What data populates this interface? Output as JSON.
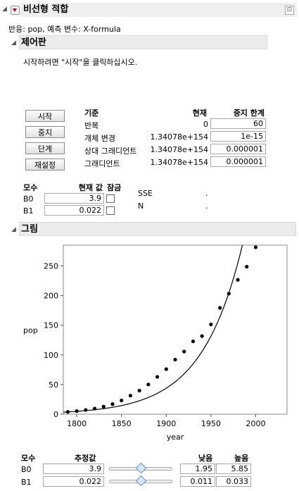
{
  "window": {
    "title": "비선형 적합"
  },
  "response_line": "반응: pop, 예측 변수: X-formula",
  "control_panel": {
    "title": "제어판",
    "instruction": "시작하려면 \"시작\"을 클릭하십시오.",
    "buttons": {
      "start": "시작",
      "stop": "중지",
      "step": "단계",
      "reset": "재설정"
    },
    "criteria_headers": {
      "criterion": "기준",
      "current": "현재",
      "stop_limit": "중지 한계"
    },
    "criteria_rows": [
      {
        "label": "반복",
        "current": "0",
        "limit": "60"
      },
      {
        "label": "개체 변경",
        "current": "1.34078e+154",
        "limit": "1e-15"
      },
      {
        "label": "상대 그래디언트",
        "current": "1.34078e+154",
        "limit": "0.000001"
      },
      {
        "label": "그래디언트",
        "current": "1.34078e+154",
        "limit": "0.000001"
      }
    ],
    "param_headers": {
      "param": "모수",
      "current_value": "현재 값",
      "lock": "잠금"
    },
    "params": [
      {
        "name": "B0",
        "value": "3.9"
      },
      {
        "name": "B1",
        "value": "0.022"
      }
    ],
    "stats": [
      {
        "label": "SSE",
        "value": "."
      },
      {
        "label": "N",
        "value": "."
      }
    ]
  },
  "plot_section": {
    "title": "그림",
    "param_headers": {
      "param": "모수",
      "estimate": "추정값",
      "low": "낮음",
      "high": "높음"
    },
    "params": [
      {
        "name": "B0",
        "estimate": "3.9",
        "low": "1.95",
        "high": "5.85",
        "slider_fraction": 0.5
      },
      {
        "name": "B1",
        "estimate": "0.022",
        "low": "0.011",
        "high": "0.033",
        "slider_fraction": 0.5
      }
    ]
  },
  "chart_data": {
    "type": "scatter",
    "xlabel": "year",
    "ylabel": "pop",
    "xlim": [
      1785,
      2035
    ],
    "ylim": [
      0,
      285
    ],
    "x_ticks": [
      1800,
      1850,
      1900,
      1950,
      2000
    ],
    "y_ticks": [
      0,
      50,
      100,
      150,
      200,
      250
    ],
    "points": [
      [
        1790,
        3.9
      ],
      [
        1800,
        5.3
      ],
      [
        1810,
        7.2
      ],
      [
        1820,
        9.6
      ],
      [
        1830,
        12.9
      ],
      [
        1840,
        17.1
      ],
      [
        1850,
        23.2
      ],
      [
        1860,
        31.4
      ],
      [
        1870,
        39.8
      ],
      [
        1880,
        50.2
      ],
      [
        1890,
        62.9
      ],
      [
        1900,
        76.0
      ],
      [
        1910,
        92.0
      ],
      [
        1920,
        105.7
      ],
      [
        1930,
        122.8
      ],
      [
        1940,
        131.7
      ],
      [
        1950,
        151.3
      ],
      [
        1960,
        179.3
      ],
      [
        1970,
        203.3
      ],
      [
        1980,
        226.5
      ],
      [
        1990,
        248.7
      ],
      [
        2000,
        281.4
      ]
    ],
    "curve": {
      "formula": "B0*exp(B1*(year-1790))",
      "b0": 3.9,
      "b1": 0.022
    },
    "grid": false
  }
}
